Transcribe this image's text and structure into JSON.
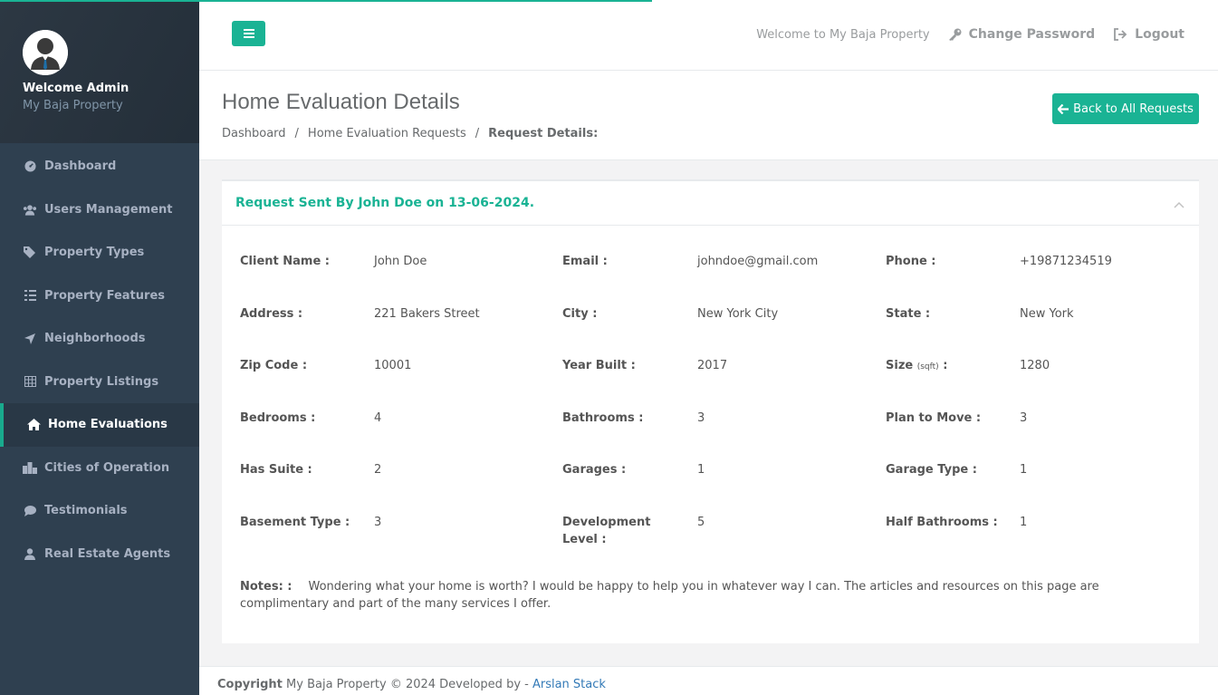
{
  "sidebar": {
    "welcome_name": "Welcome Admin",
    "welcome_sub": "My Baja Property",
    "items": [
      {
        "label": "Dashboard",
        "icon": "dashboard-icon"
      },
      {
        "label": "Users Management",
        "icon": "users-icon"
      },
      {
        "label": "Property Types",
        "icon": "tags-icon"
      },
      {
        "label": "Property Features",
        "icon": "list-icon"
      },
      {
        "label": "Neighborhoods",
        "icon": "location-arrow-icon"
      },
      {
        "label": "Property Listings",
        "icon": "table-icon"
      },
      {
        "label": "Home Evaluations",
        "icon": "home-icon",
        "active": true
      },
      {
        "label": "Cities of Operation",
        "icon": "city-icon"
      },
      {
        "label": "Testimonials",
        "icon": "comment-icon"
      },
      {
        "label": "Real Estate Agents",
        "icon": "user-icon"
      }
    ]
  },
  "topbar": {
    "welcome": "Welcome to My Baja Property",
    "change_password": "Change Password",
    "logout": "Logout"
  },
  "heading": {
    "title": "Home Evaluation Details",
    "breadcrumb": [
      "Dashboard",
      "Home Evaluation Requests",
      "Request Details:"
    ],
    "back_button": "Back to All Requests"
  },
  "panel": {
    "title": "Request Sent By John Doe on 13-06-2024.",
    "fields": {
      "client_name": {
        "label": "Client Name :",
        "value": "John Doe"
      },
      "email": {
        "label": "Email :",
        "value": "johndoe@gmail.com"
      },
      "phone": {
        "label": "Phone :",
        "value": "+19871234519"
      },
      "address": {
        "label": "Address :",
        "value": "221 Bakers Street"
      },
      "city": {
        "label": "City :",
        "value": "New York City"
      },
      "state": {
        "label": "State :",
        "value": "New York"
      },
      "zip": {
        "label": "Zip Code :",
        "value": "10001"
      },
      "year_built": {
        "label": "Year Built :",
        "value": "2017"
      },
      "size": {
        "label": "Size",
        "unit": "(sqft)",
        "colon": " :",
        "value": "1280"
      },
      "bedrooms": {
        "label": "Bedrooms :",
        "value": "4"
      },
      "bathrooms": {
        "label": "Bathrooms :",
        "value": "3"
      },
      "plan_to_move": {
        "label": "Plan to Move :",
        "value": "3"
      },
      "has_suite": {
        "label": "Has Suite :",
        "value": "2"
      },
      "garages": {
        "label": "Garages :",
        "value": "1"
      },
      "garage_type": {
        "label": "Garage Type :",
        "value": "1"
      },
      "basement_type": {
        "label": "Basement Type :",
        "value": "3"
      },
      "development_level": {
        "label": "Development Level :",
        "value": "5"
      },
      "half_bathrooms": {
        "label": "Half Bathrooms :",
        "value": "1"
      }
    },
    "notes_label": "Notes: :",
    "notes": "Wondering what your home is worth? I would be happy to help you in whatever way I can. The articles and resources on this page are complimentary and part of the many services I offer."
  },
  "footer": {
    "copyright": "Copyright",
    "text": " My Baja Property © 2024 Developed by - ",
    "developer": "Arslan Stack"
  },
  "colors": {
    "accent": "#1ab394",
    "sidebar": "#2f4050",
    "link": "#337ab7"
  }
}
